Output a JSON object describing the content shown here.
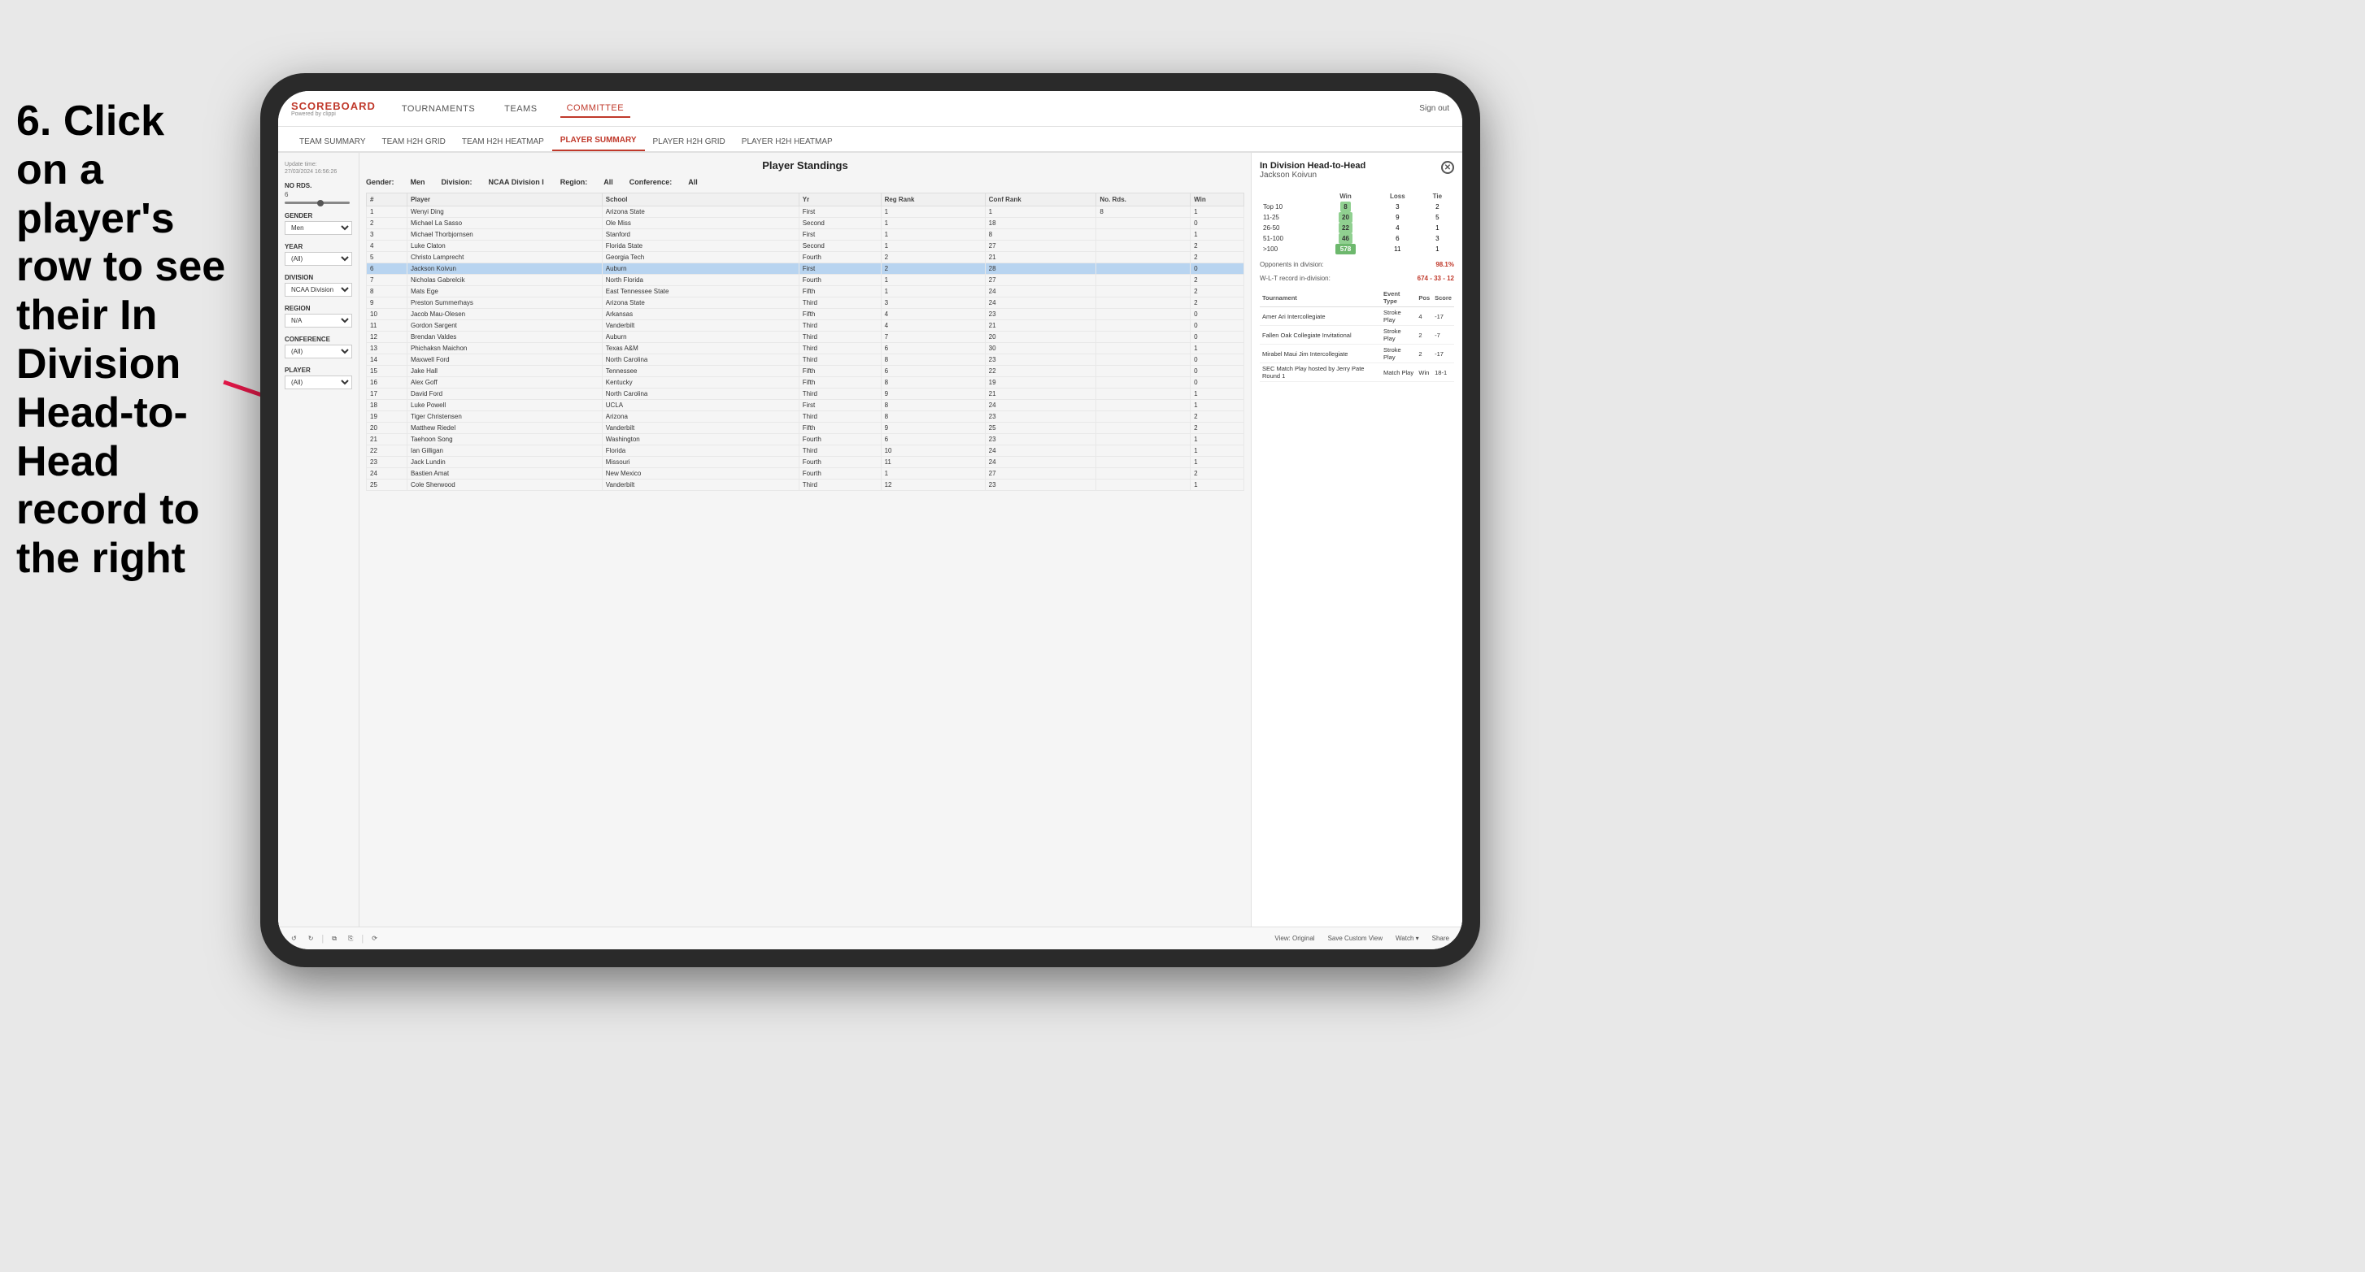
{
  "instruction": {
    "text": "6. Click on a player's row to see their In Division Head-to-Head record to the right"
  },
  "app": {
    "logo": "SCOREBOARD",
    "logo_sub": "Powered by clippi",
    "sign_out": "Sign out",
    "nav": {
      "items": [
        "TOURNAMENTS",
        "TEAMS",
        "COMMITTEE"
      ],
      "active": "COMMITTEE"
    },
    "sub_nav": {
      "items": [
        "TEAM SUMMARY",
        "TEAM H2H GRID",
        "TEAM H2H HEATMAP",
        "PLAYER SUMMARY",
        "PLAYER H2H GRID",
        "PLAYER H2H HEATMAP"
      ],
      "active": "PLAYER SUMMARY"
    }
  },
  "sidebar": {
    "update_time_label": "Update time:",
    "update_time": "27/03/2024 16:56:26",
    "no_rds_label": "No Rds.",
    "no_rds_value": "6",
    "gender_label": "Gender",
    "gender_value": "Men",
    "year_label": "Year",
    "year_value": "(All)",
    "division_label": "Division",
    "division_value": "NCAA Division I",
    "region_label": "Region",
    "region_value": "N/A",
    "conference_label": "Conference",
    "conference_value": "(All)",
    "player_label": "Player",
    "player_value": "(All)"
  },
  "table": {
    "title": "Player Standings",
    "filters": {
      "gender_label": "Gender:",
      "gender_value": "Men",
      "division_label": "Division:",
      "division_value": "NCAA Division I",
      "region_label": "Region:",
      "region_value": "All",
      "conference_label": "Conference:",
      "conference_value": "All"
    },
    "columns": [
      "#",
      "Player",
      "School",
      "Yr",
      "Reg Rank",
      "Conf Rank",
      "No. Rds.",
      "Win"
    ],
    "rows": [
      {
        "num": 1,
        "player": "Wenyi Ding",
        "school": "Arizona State",
        "yr": "First",
        "reg": 1,
        "conf": 1,
        "rds": 8,
        "win": 1
      },
      {
        "num": 2,
        "player": "Michael La Sasso",
        "school": "Ole Miss",
        "yr": "Second",
        "reg": 1,
        "conf": 18,
        "win": 0
      },
      {
        "num": 3,
        "player": "Michael Thorbjornsen",
        "school": "Stanford",
        "yr": "First",
        "reg": 1,
        "conf": 8,
        "win": 1
      },
      {
        "num": 4,
        "player": "Luke Claton",
        "school": "Florida State",
        "yr": "Second",
        "reg": 1,
        "conf": 27,
        "win": 2
      },
      {
        "num": 5,
        "player": "Christo Lamprecht",
        "school": "Georgia Tech",
        "yr": "Fourth",
        "reg": 2,
        "conf": 21,
        "win": 2
      },
      {
        "num": 6,
        "player": "Jackson Koivun",
        "school": "Auburn",
        "yr": "First",
        "reg": 2,
        "conf": 28,
        "win": 0,
        "selected": true
      },
      {
        "num": 7,
        "player": "Nicholas Gabrelcik",
        "school": "North Florida",
        "yr": "Fourth",
        "reg": 1,
        "conf": 27,
        "win": 2
      },
      {
        "num": 8,
        "player": "Mats Ege",
        "school": "East Tennessee State",
        "yr": "Fifth",
        "reg": 1,
        "conf": 24,
        "win": 2
      },
      {
        "num": 9,
        "player": "Preston Summerhays",
        "school": "Arizona State",
        "yr": "Third",
        "reg": 3,
        "conf": 24,
        "win": 2
      },
      {
        "num": 10,
        "player": "Jacob Mau-Olesen",
        "school": "Arkansas",
        "yr": "Fifth",
        "reg": 4,
        "conf": 23,
        "win": 0
      },
      {
        "num": 11,
        "player": "Gordon Sargent",
        "school": "Vanderbilt",
        "yr": "Third",
        "reg": 4,
        "conf": 21,
        "win": 0
      },
      {
        "num": 12,
        "player": "Brendan Valdes",
        "school": "Auburn",
        "yr": "Third",
        "reg": 7,
        "conf": 20,
        "win": 0
      },
      {
        "num": 13,
        "player": "Phichaksn Maichon",
        "school": "Texas A&M",
        "yr": "Third",
        "reg": 6,
        "conf": 30,
        "win": 1
      },
      {
        "num": 14,
        "player": "Maxwell Ford",
        "school": "North Carolina",
        "yr": "Third",
        "reg": 8,
        "conf": 23,
        "win": 0
      },
      {
        "num": 15,
        "player": "Jake Hall",
        "school": "Tennessee",
        "yr": "Fifth",
        "reg": 6,
        "conf": 22,
        "win": 0
      },
      {
        "num": 16,
        "player": "Alex Goff",
        "school": "Kentucky",
        "yr": "Fifth",
        "reg": 8,
        "conf": 19,
        "win": 0
      },
      {
        "num": 17,
        "player": "David Ford",
        "school": "North Carolina",
        "yr": "Third",
        "reg": 9,
        "conf": 21,
        "win": 1
      },
      {
        "num": 18,
        "player": "Luke Powell",
        "school": "UCLA",
        "yr": "First",
        "reg": 8,
        "conf": 24,
        "win": 1
      },
      {
        "num": 19,
        "player": "Tiger Christensen",
        "school": "Arizona",
        "yr": "Third",
        "reg": 8,
        "conf": 23,
        "win": 2
      },
      {
        "num": 20,
        "player": "Matthew Riedel",
        "school": "Vanderbilt",
        "yr": "Fifth",
        "reg": 9,
        "conf": 25,
        "win": 2
      },
      {
        "num": 21,
        "player": "Taehoon Song",
        "school": "Washington",
        "yr": "Fourth",
        "reg": 6,
        "conf": 23,
        "win": 1
      },
      {
        "num": 22,
        "player": "Ian Gilligan",
        "school": "Florida",
        "yr": "Third",
        "reg": 10,
        "conf": 24,
        "win": 1
      },
      {
        "num": 23,
        "player": "Jack Lundin",
        "school": "Missouri",
        "yr": "Fourth",
        "reg": 11,
        "conf": 24,
        "win": 1
      },
      {
        "num": 24,
        "player": "Bastien Amat",
        "school": "New Mexico",
        "yr": "Fourth",
        "reg": 1,
        "conf": 27,
        "win": 2
      },
      {
        "num": 25,
        "player": "Cole Sherwood",
        "school": "Vanderbilt",
        "yr": "Third",
        "reg": 12,
        "conf": 23,
        "win": 1
      }
    ]
  },
  "right_panel": {
    "title": "In Division Head-to-Head",
    "player_name": "Jackson Koivun",
    "col_win": "Win",
    "col_loss": "Loss",
    "col_tie": "Tie",
    "h2h_rows": [
      {
        "label": "Top 10",
        "win": 8,
        "loss": 3,
        "tie": 2
      },
      {
        "label": "11-25",
        "win": 20,
        "loss": 9,
        "tie": 5
      },
      {
        "label": "26-50",
        "win": 22,
        "loss": 4,
        "tie": 1
      },
      {
        "label": "51-100",
        "win": 46,
        "loss": 6,
        "tie": 3
      },
      {
        "label": ">100",
        "win": 578,
        "loss": 11,
        "tie": 1
      }
    ],
    "opponents_label": "Opponents in division:",
    "opponents_value": "98.1%",
    "record_label": "W-L-T record in-division:",
    "record_value": "674 - 33 - 12",
    "tournaments_columns": [
      "Tournament",
      "Event Type",
      "Pos",
      "Score"
    ],
    "tournaments": [
      {
        "name": "Amer Ari Intercollegiate",
        "type": "Stroke Play",
        "pos": 4,
        "score": "-17"
      },
      {
        "name": "Fallen Oak Collegiate Invitational",
        "type": "Stroke Play",
        "pos": 2,
        "score": "-7"
      },
      {
        "name": "Mirabel Maui Jim Intercollegiate",
        "type": "Stroke Play",
        "pos": 2,
        "score": "-17"
      },
      {
        "name": "SEC Match Play hosted by Jerry Pate Round 1",
        "type": "Match Play",
        "pos": "Win",
        "score": "18-1"
      }
    ]
  },
  "toolbar": {
    "undo": "↺",
    "redo": "↻",
    "view_original": "View: Original",
    "save_custom": "Save Custom View",
    "watch": "Watch ▾",
    "share": "Share"
  }
}
